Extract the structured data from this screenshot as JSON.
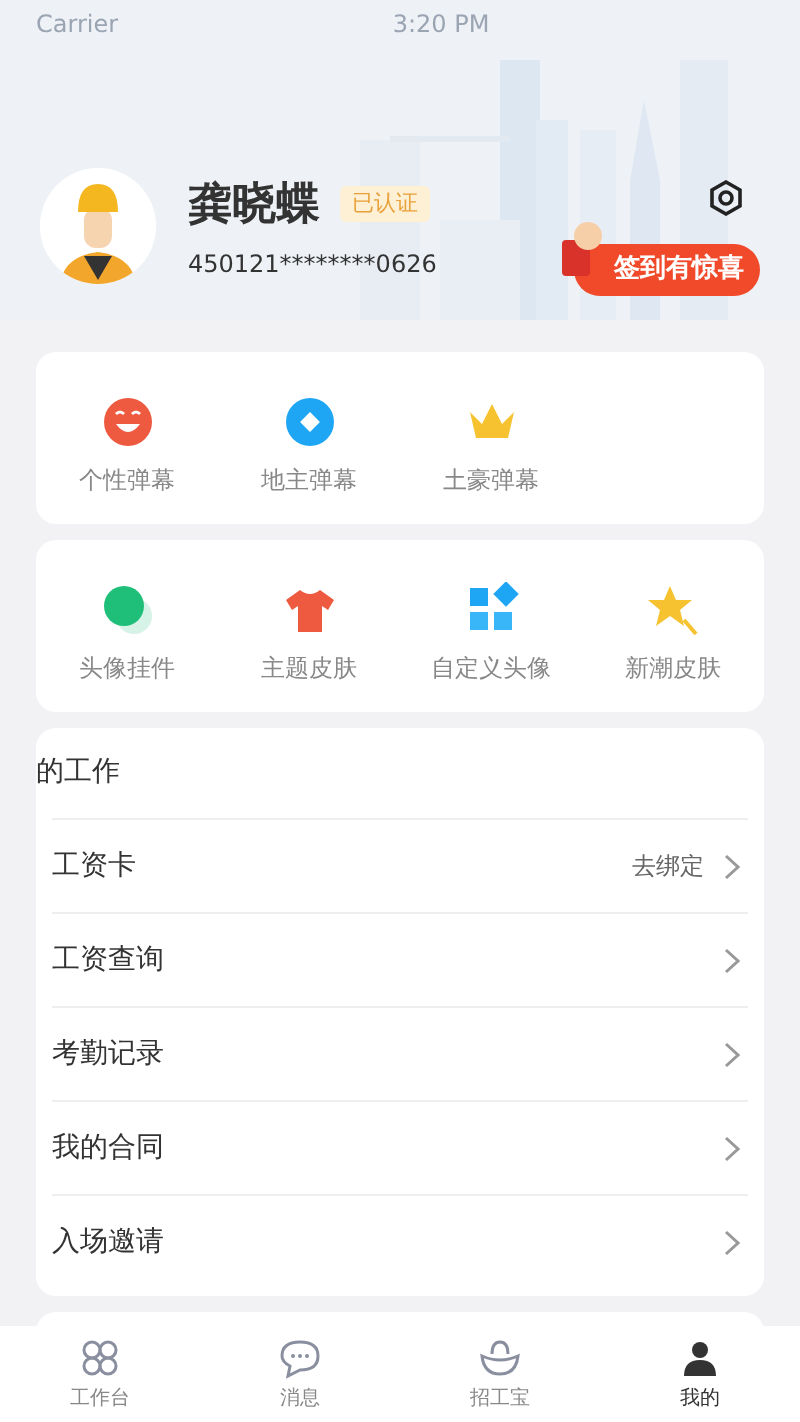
{
  "status_bar": {
    "carrier": "Carrier",
    "time": "3:20 PM"
  },
  "profile": {
    "name": "龚晓蝶",
    "badge": "已认证",
    "id_number": "450121********0626",
    "checkin_button": "签到有惊喜"
  },
  "danmaku": [
    {
      "label": "个性弹幕"
    },
    {
      "label": "地主弹幕"
    },
    {
      "label": "土豪弹幕"
    }
  ],
  "skins": [
    {
      "label": "头像挂件"
    },
    {
      "label": "主题皮肤"
    },
    {
      "label": "自定义头像"
    },
    {
      "label": "新潮皮肤"
    }
  ],
  "work": {
    "title": "的工作",
    "items": [
      {
        "label": "工资卡",
        "action": "去绑定"
      },
      {
        "label": "工资查询"
      },
      {
        "label": "考勤记录"
      },
      {
        "label": "我的合同"
      },
      {
        "label": "入场邀请"
      }
    ]
  },
  "tab_bar": [
    {
      "label": "工作台",
      "selected": false
    },
    {
      "label": "消息",
      "selected": false
    },
    {
      "label": "招工宝",
      "selected": false
    },
    {
      "label": "我的",
      "selected": true
    }
  ]
}
